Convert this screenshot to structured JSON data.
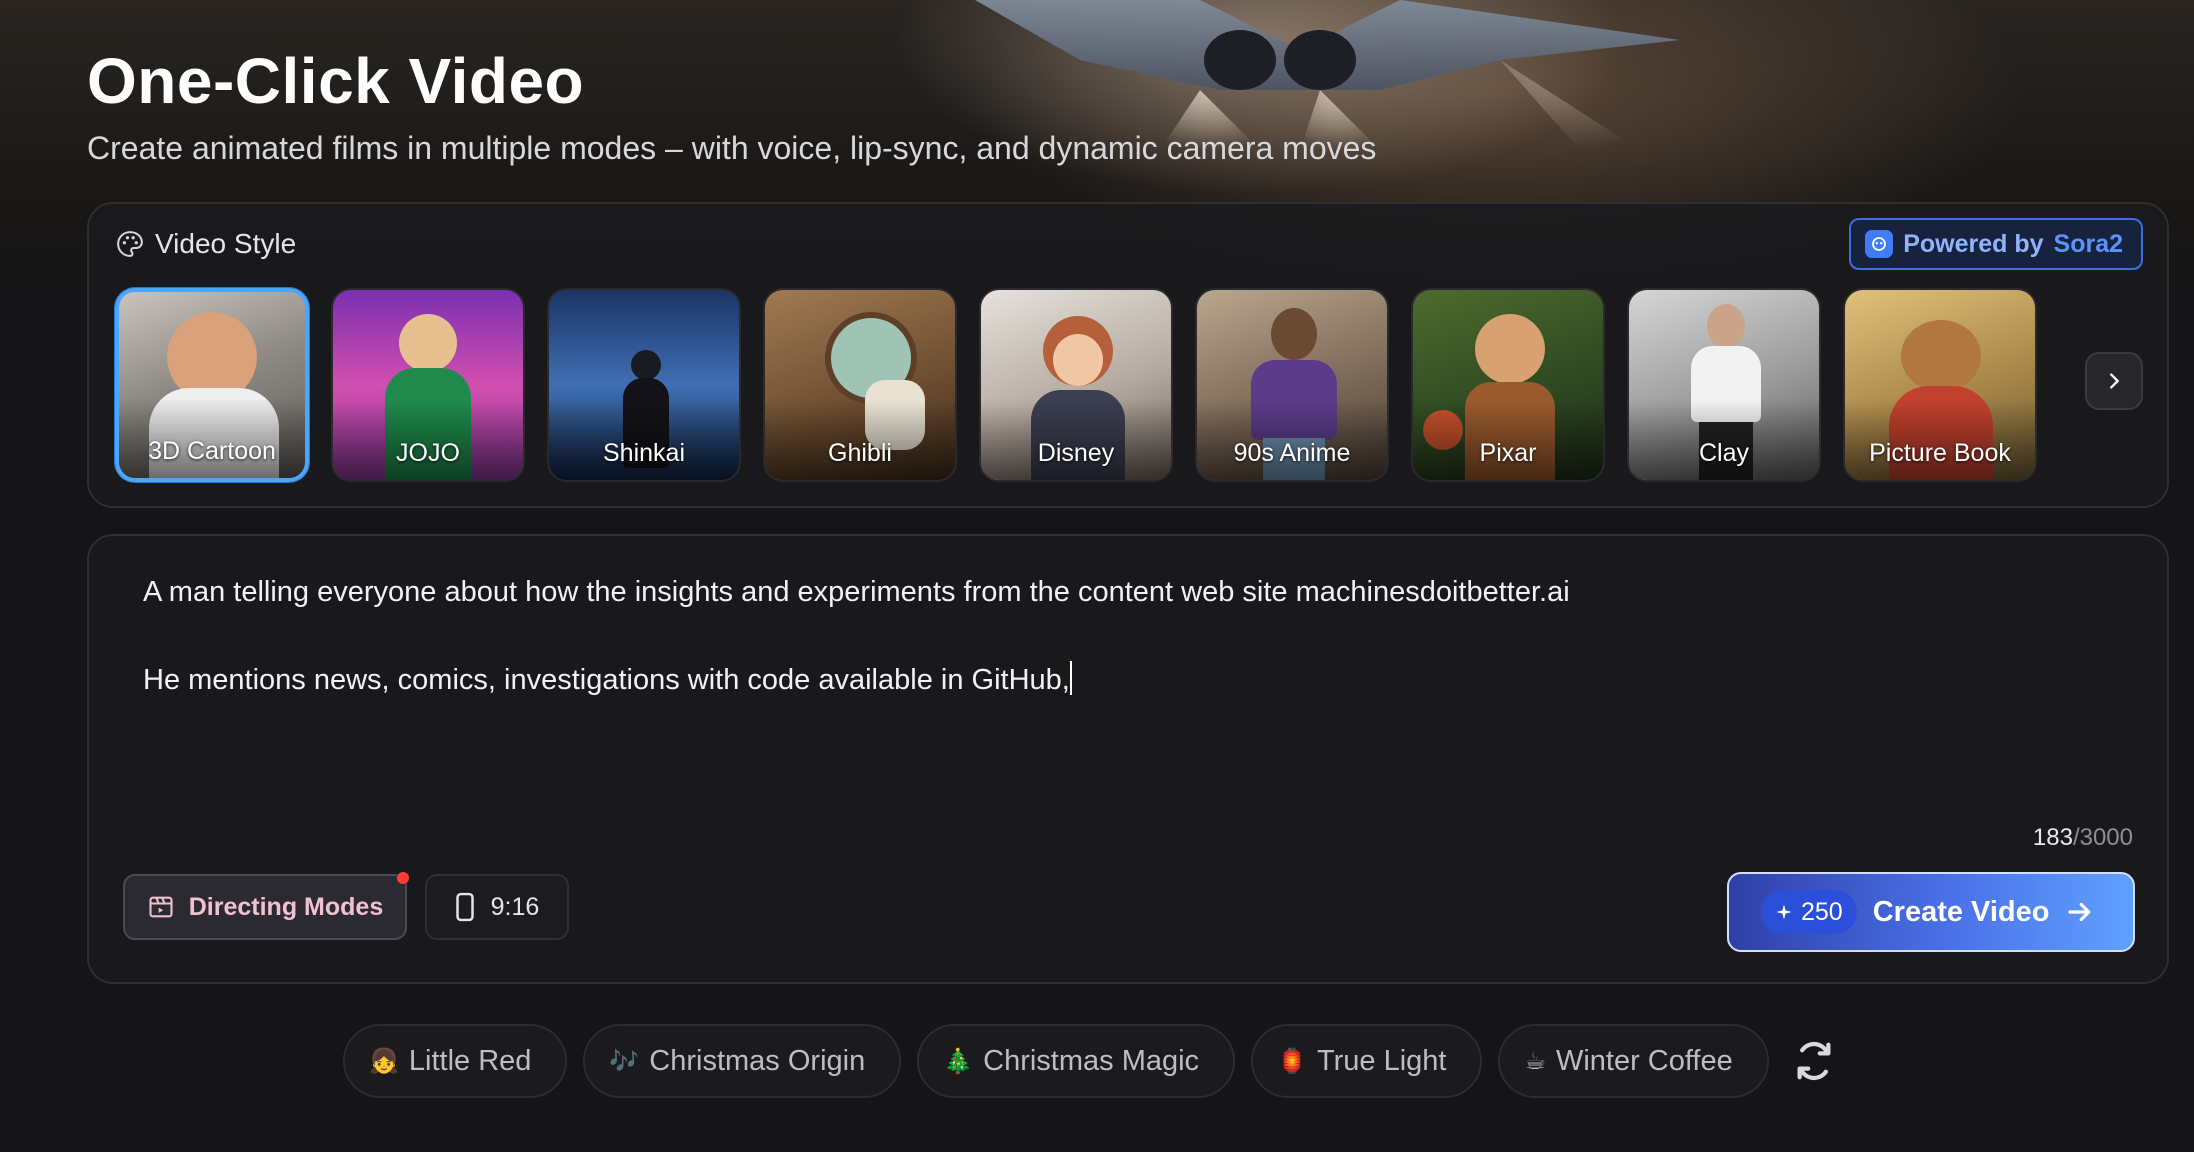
{
  "header": {
    "title": "One-Click Video",
    "subtitle": "Create animated films in multiple modes – with voice, lip-sync, and dynamic camera moves"
  },
  "style_panel": {
    "label": "Video Style",
    "powered_prefix": "Powered by",
    "powered_brand": "Sora2",
    "styles": [
      {
        "label": "3D Cartoon",
        "selected": true
      },
      {
        "label": "JOJO",
        "selected": false
      },
      {
        "label": "Shinkai",
        "selected": false
      },
      {
        "label": "Ghibli",
        "selected": false
      },
      {
        "label": "Disney",
        "selected": false
      },
      {
        "label": "90s Anime",
        "selected": false
      },
      {
        "label": "Pixar",
        "selected": false
      },
      {
        "label": "Clay",
        "selected": false
      },
      {
        "label": "Picture Book",
        "selected": false
      }
    ]
  },
  "prompt": {
    "text": "A man telling everyone about how the insights and experiments from the content web site machinesdoitbetter.ai\n\nHe mentions news, comics, investigations with code available in GitHub,",
    "count": "183",
    "max": "/3000"
  },
  "toolbar": {
    "directing_label": "Directing Modes",
    "ratio_label": "9:16",
    "credits": "250",
    "create_label": "Create Video"
  },
  "suggestions": [
    {
      "emoji": "👧",
      "label": "Little Red"
    },
    {
      "emoji": "🎶",
      "label": "Christmas Origin"
    },
    {
      "emoji": "🎄",
      "label": "Christmas Magic"
    },
    {
      "emoji": "🏮",
      "label": "True Light"
    },
    {
      "emoji": "☕",
      "label": "Winter Coffee"
    }
  ],
  "colors": {
    "accent": "#48a6ff",
    "create_start": "#2f3fa8",
    "create_end": "#5fa0ff",
    "badge_dot": "#ff3b3b"
  }
}
